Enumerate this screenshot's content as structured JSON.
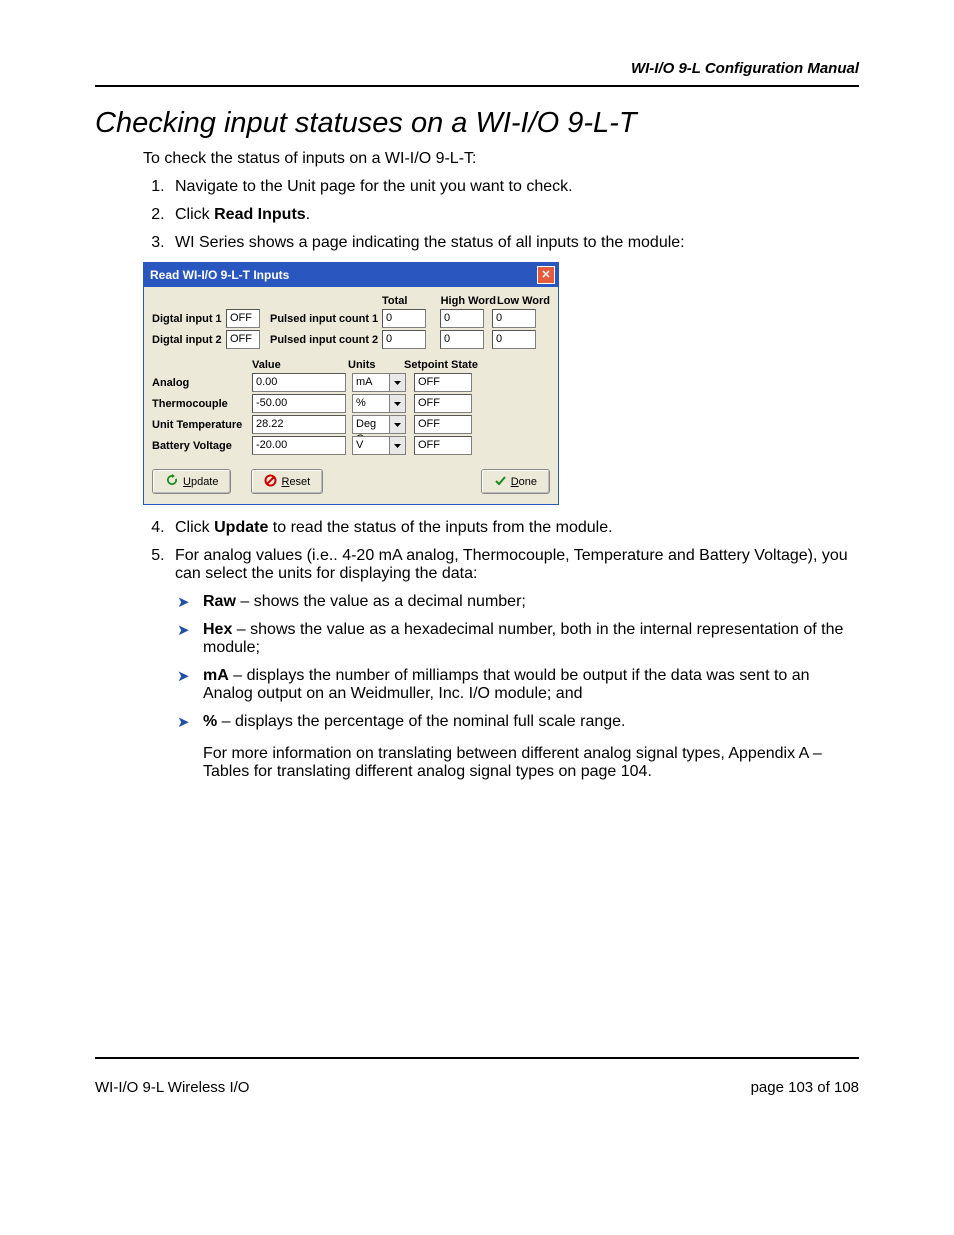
{
  "doc": {
    "header_right": "WI-I/O 9-L Configuration Manual",
    "heading": "Checking input statuses on a WI-I/O 9-L-T",
    "intro": "To check the status of inputs on a WI-I/O 9-L-T:",
    "step1": "Navigate to the Unit page for the unit you want to check.",
    "step2_prefix": "Click ",
    "step2_bold": "Read Inputs",
    "step2_suffix": ".",
    "step3": "WI Series shows a page indicating the status of all inputs to the module:",
    "step4_prefix": "Click ",
    "step4_bold": "Update",
    "step4_suffix": " to read the status of the inputs from the module.",
    "step5": "For analog values (i.e.. 4-20 mA analog, Thermocouple, Temperature and Battery Voltage), you can select the units for displaying the data:",
    "bullets": {
      "raw_bold": "Raw",
      "raw_text": " – shows the value as a decimal number;",
      "hex_bold": "Hex",
      "hex_text": " – shows the value as a hexadecimal number, both in the internal representation of the module;",
      "ma_bold": "mA",
      "ma_text": " – displays the number of milliamps that would be output if the data was sent to an Analog output on an Weidmuller, Inc. I/O module; and",
      "pct_bold": "%",
      "pct_text": " – displays the percentage of the nominal full scale range."
    },
    "closing": "For more information on translating between different analog signal types, Appendix A – Tables for translating different analog signal types on page 104.",
    "footer_left": "WI-I/O 9-L Wireless I/O",
    "footer_right": "page  103 of 108"
  },
  "dlg": {
    "title": "Read WI-I/O 9-L-T Inputs",
    "columns": {
      "total": "Total",
      "high": "High Word",
      "low": "Low Word"
    },
    "digital": [
      {
        "label": "Digtal input 1",
        "state": "OFF",
        "pulsed_label": "Pulsed input count 1",
        "total": "0",
        "high": "0",
        "low": "0"
      },
      {
        "label": "Digtal input 2",
        "state": "OFF",
        "pulsed_label": "Pulsed input count 2",
        "total": "0",
        "high": "0",
        "low": "0"
      }
    ],
    "analog_headers": {
      "value": "Value",
      "units": "Units",
      "setpoint": "Setpoint State"
    },
    "analog": [
      {
        "label": "Analog",
        "value": "0.00",
        "units": "mA",
        "setpoint": "OFF"
      },
      {
        "label": "Thermocouple",
        "value": "-50.00",
        "units": "%",
        "setpoint": "OFF"
      },
      {
        "label": "Unit Temperature",
        "value": "28.22",
        "units": "Deg C",
        "setpoint": "OFF"
      },
      {
        "label": "Battery Voltage",
        "value": "-20.00",
        "units": "V",
        "setpoint": "OFF"
      }
    ],
    "buttons": {
      "update": "Update",
      "reset": "Reset",
      "done": "Done"
    }
  }
}
